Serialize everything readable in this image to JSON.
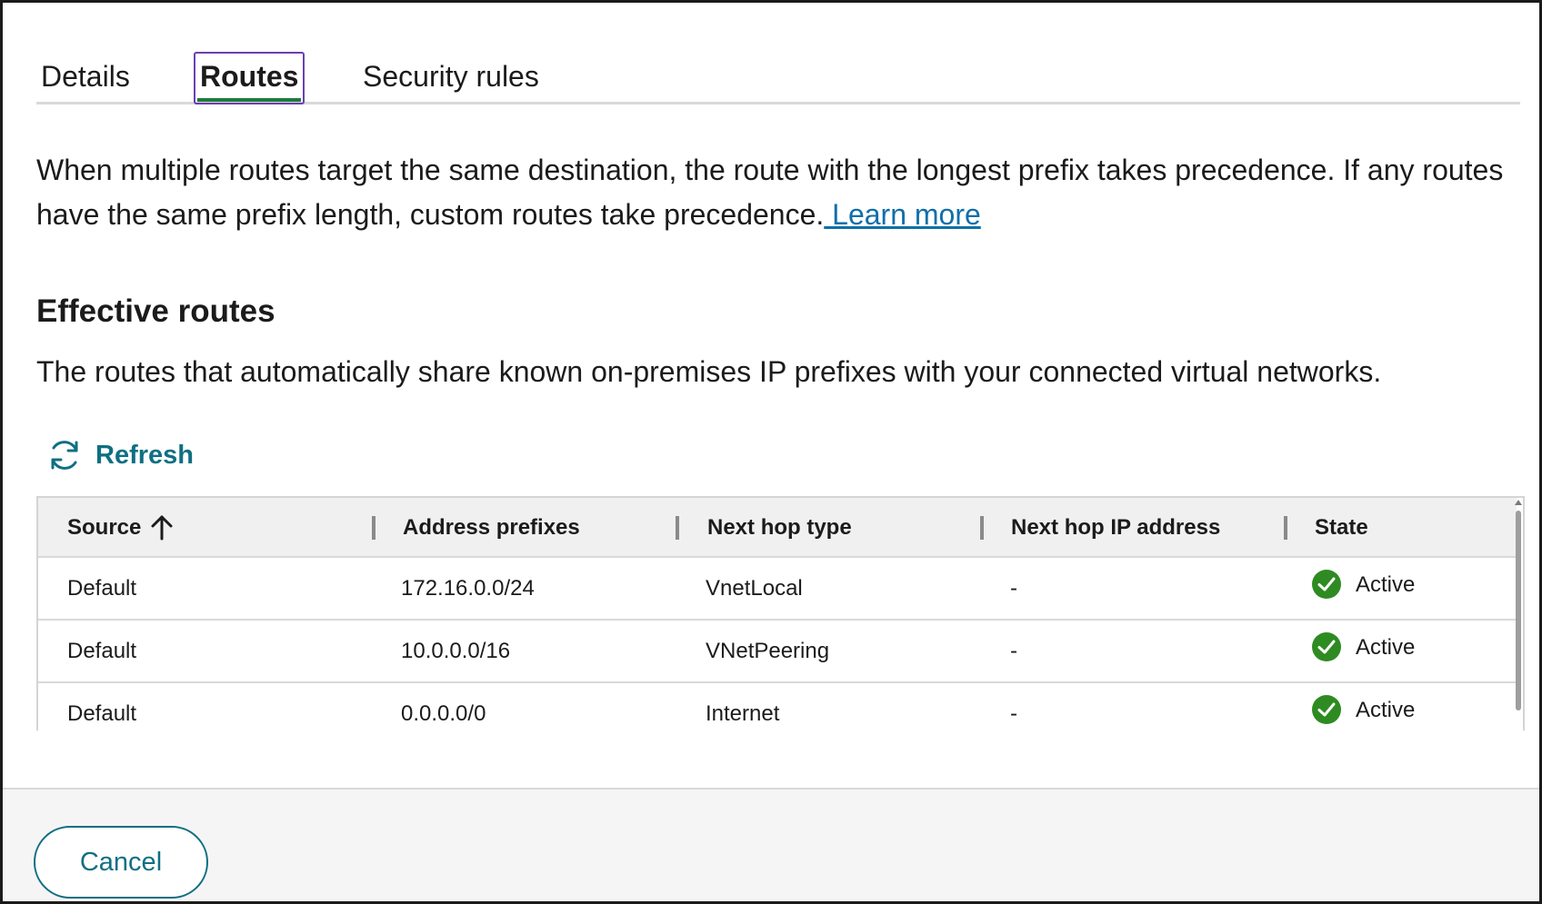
{
  "tabs": [
    {
      "label": "Details",
      "selected": false
    },
    {
      "label": "Routes",
      "selected": true
    },
    {
      "label": "Security rules",
      "selected": false
    }
  ],
  "intro": {
    "text": "When multiple routes target the same destination, the route with the longest prefix takes precedence. If any routes have the same prefix length, custom routes take precedence.",
    "link": " Learn more"
  },
  "section": {
    "title": "Effective routes",
    "description": "The routes that automatically share known on-premises IP prefixes with your connected virtual networks."
  },
  "toolbar": {
    "refresh_label": "Refresh",
    "refresh_icon": "refresh-icon"
  },
  "table": {
    "columns": [
      "Source",
      "Address prefixes",
      "Next hop type",
      "Next hop IP address",
      "State"
    ],
    "sort": {
      "column": "Source",
      "direction": "ascending",
      "icon": "arrow-up-icon"
    },
    "rows": [
      {
        "source": "Default",
        "address_prefix": "172.16.0.0/24",
        "next_hop_type": "VnetLocal",
        "next_hop_ip": "-",
        "state": "Active"
      },
      {
        "source": "Default",
        "address_prefix": "10.0.0.0/16",
        "next_hop_type": "VNetPeering",
        "next_hop_ip": "-",
        "state": "Active"
      },
      {
        "source": "Default",
        "address_prefix": "0.0.0.0/0",
        "next_hop_type": "Internet",
        "next_hop_ip": "-",
        "state": "Active"
      }
    ],
    "state_icon": "check-circle-icon"
  },
  "footer": {
    "cancel_label": "Cancel"
  },
  "colors": {
    "accent": "#0f6f83",
    "link": "#0f6fa8",
    "active_tab_underline": "#1f7a3d",
    "focus_outline": "#6b3fb3",
    "success": "#2e8b22"
  }
}
